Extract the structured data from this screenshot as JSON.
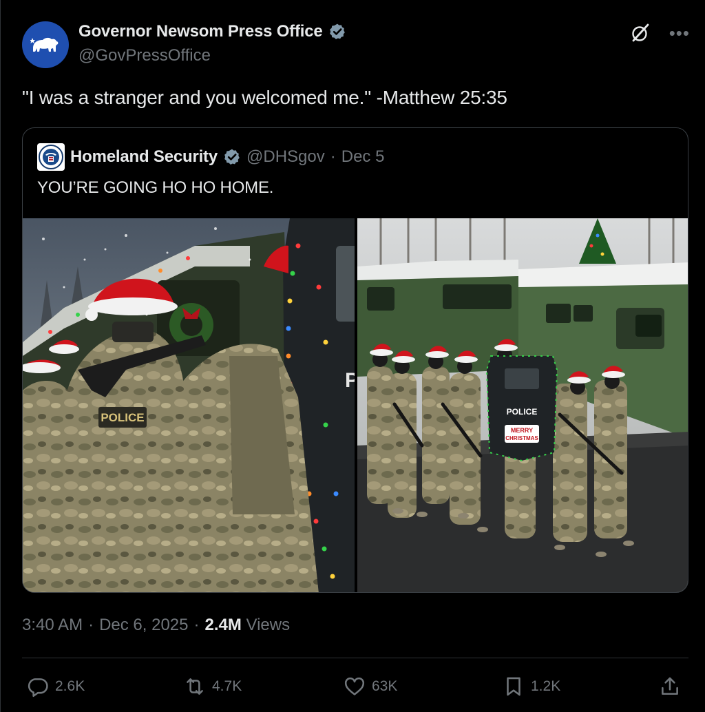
{
  "post": {
    "author_name": "Governor Newsom Press Office",
    "author_handle": "@GovPressOffice",
    "text": "\"I was a stranger and you welcomed me.\" -Matthew 25:35",
    "time": "3:40 AM",
    "date": "Dec 6, 2025",
    "views_count": "2.4M",
    "views_label": "Views",
    "separator": "·"
  },
  "quoted_post": {
    "author_name": "Homeland Security",
    "author_handle": "@DHSgov",
    "separator": "·",
    "date": "Dec 5",
    "text": "YOU’RE GOING HO HO HOME.",
    "media_left_shield_text": "POLICE",
    "media_left_patch_text": "POLICE",
    "media_left_edge_letter": "P",
    "media_right_shield_text": "POLICE",
    "media_right_sign_line1": "MERRY",
    "media_right_sign_line2": "CHRISTMAS"
  },
  "actions": {
    "replies": "2.6K",
    "reposts": "4.7K",
    "likes": "63K",
    "bookmarks": "1.2K"
  },
  "colors": {
    "background": "#000000",
    "text_primary": "#e7e9ea",
    "text_secondary": "#71767b",
    "verified_badge": "#829aab",
    "avatar_blue": "#1f4fb0",
    "border": "#2f3336"
  },
  "icons": {
    "verified": "verified-badge-icon",
    "grok": "grok-icon",
    "more": "more-icon",
    "reply": "reply-icon",
    "repost": "repost-icon",
    "like": "heart-icon",
    "bookmark": "bookmark-icon",
    "share": "share-icon"
  }
}
